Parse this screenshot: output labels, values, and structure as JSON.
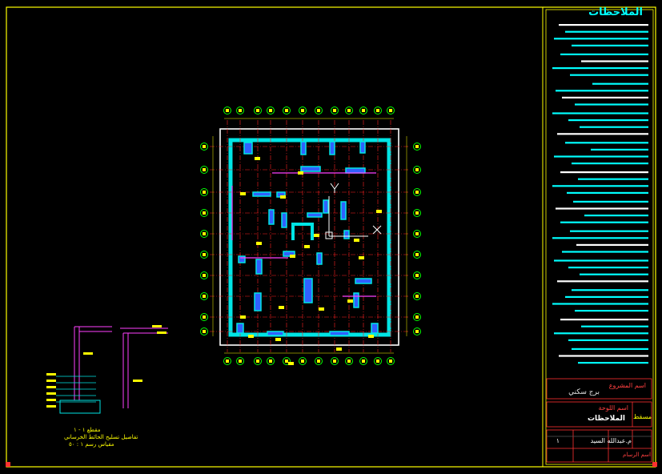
{
  "notes": {
    "title": "الملاحظات"
  },
  "title_block": {
    "project_label": "اسم المشروع",
    "project_name": "برج سكني",
    "drawing_label": "اسم اللوحة",
    "drawing_name": "الملاحظات",
    "plan_label": "مسقط",
    "engineer_label": "م.عبدالله السيد",
    "sheet_no": "١",
    "footer_left": "اسم الرسام"
  },
  "detail": {
    "title": "مقطع ١ - ١",
    "subtitle": "تفاصيل تسليح الحائط الخرساني",
    "scale": "مقياس رسم ١ : ٥٠"
  },
  "colors": {
    "frame": "#ffff00",
    "grid": "#ff2020",
    "wall": "#00e5e5",
    "column": "#4040ff",
    "bubble": "#00ff00",
    "text": "#ffff00",
    "notes_text": "#00ffff",
    "border": "#ffffff"
  },
  "ucs": {
    "x_label": "X",
    "y_label": "Y"
  }
}
